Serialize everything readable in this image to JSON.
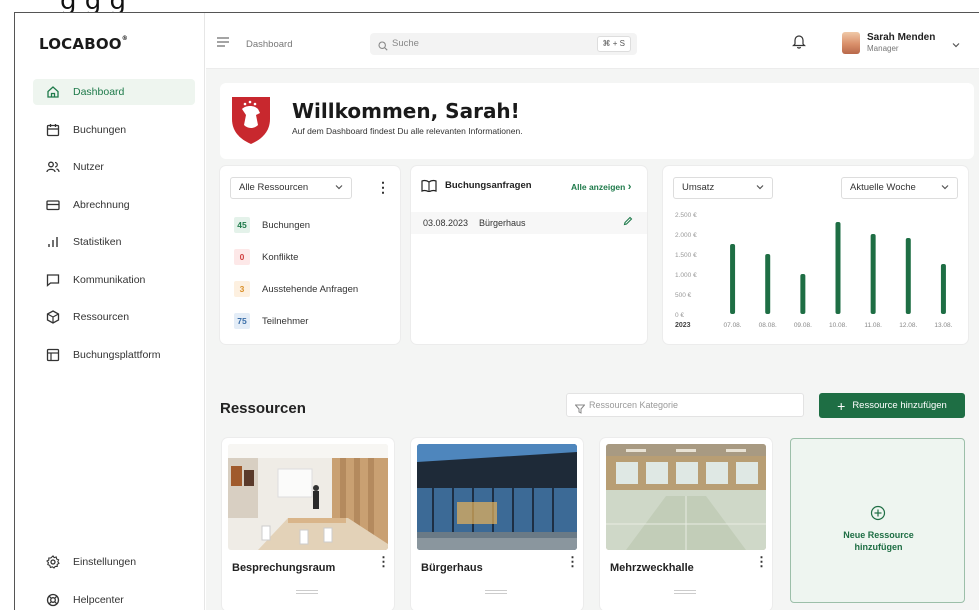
{
  "header_crop_text": "g                                    g  g",
  "app": {
    "logo": "LOCABOO",
    "logo_mark": "®"
  },
  "sidebar": {
    "items": [
      {
        "label": "Dashboard",
        "icon": "home-icon",
        "active": true
      },
      {
        "label": "Buchungen",
        "icon": "calendar-icon"
      },
      {
        "label": "Nutzer",
        "icon": "users-icon"
      },
      {
        "label": "Abrechnung",
        "icon": "credit-card-icon"
      },
      {
        "label": "Statistiken",
        "icon": "bar-chart-icon"
      },
      {
        "label": "Kommunikation",
        "icon": "message-icon"
      },
      {
        "label": "Ressourcen",
        "icon": "cube-icon"
      },
      {
        "label": "Buchungsplattform",
        "icon": "layout-icon"
      }
    ],
    "bottom": [
      {
        "label": "Einstellungen",
        "icon": "gear-icon"
      },
      {
        "label": "Helpcenter",
        "icon": "lifebuoy-icon"
      }
    ]
  },
  "topbar": {
    "breadcrumb": "Dashboard",
    "search_placeholder": "Suche",
    "shortcut": "⌘ + S",
    "user_name": "Sarah Menden",
    "user_role": "Manager"
  },
  "welcome": {
    "title": "Willkommen, Sarah!",
    "subtitle": "Auf dem Dashboard findest Du alle relevanten Informationen."
  },
  "stats_card": {
    "select": "Alle Ressourcen",
    "items": [
      {
        "num": "45",
        "label": "Buchungen",
        "bg": "#e4f2ea",
        "fg": "#1e7a4a"
      },
      {
        "num": "0",
        "label": "Konflikte",
        "bg": "#fde8e8",
        "fg": "#d04040"
      },
      {
        "num": "3",
        "label": "Ausstehende Anfragen",
        "bg": "#fdf0e0",
        "fg": "#d9902a"
      },
      {
        "num": "75",
        "label": "Teilnehmer",
        "bg": "#e4edf7",
        "fg": "#3a6ea8"
      }
    ]
  },
  "requests_card": {
    "title": "Buchungsanfragen",
    "link": "Alle anzeigen",
    "rows": [
      {
        "date": "03.08.2023",
        "place": "Bürgerhaus"
      }
    ]
  },
  "chart_card": {
    "select_left": "Umsatz",
    "select_right": "Aktuelle Woche"
  },
  "chart_data": {
    "type": "bar",
    "year_label": "2023",
    "categories": [
      "07.08.",
      "08.08.",
      "09.08.",
      "10.08.",
      "11.08.",
      "12.08.",
      "13.08."
    ],
    "values": [
      1750,
      1500,
      1000,
      2300,
      2000,
      1900,
      1250
    ],
    "yticks": [
      "0 €",
      "500 €",
      "1.000 €",
      "1.500 €",
      "2.000 €",
      "2.500 €"
    ],
    "ylim": [
      0,
      2500
    ],
    "color": "#1e6e44"
  },
  "resources": {
    "title": "Ressourcen",
    "filter_placeholder": "Ressourcen Kategorie",
    "add_button": "Ressource hinzufügen",
    "cards": [
      {
        "name": "Besprechungsraum"
      },
      {
        "name": "Bürgerhaus"
      },
      {
        "name": "Mehrzweckhalle"
      }
    ],
    "new_card_line1": "Neue Ressource",
    "new_card_line2": "hinzufügen"
  },
  "colors": {
    "accent": "#1e6e44",
    "active_bg": "#eef5ef"
  }
}
